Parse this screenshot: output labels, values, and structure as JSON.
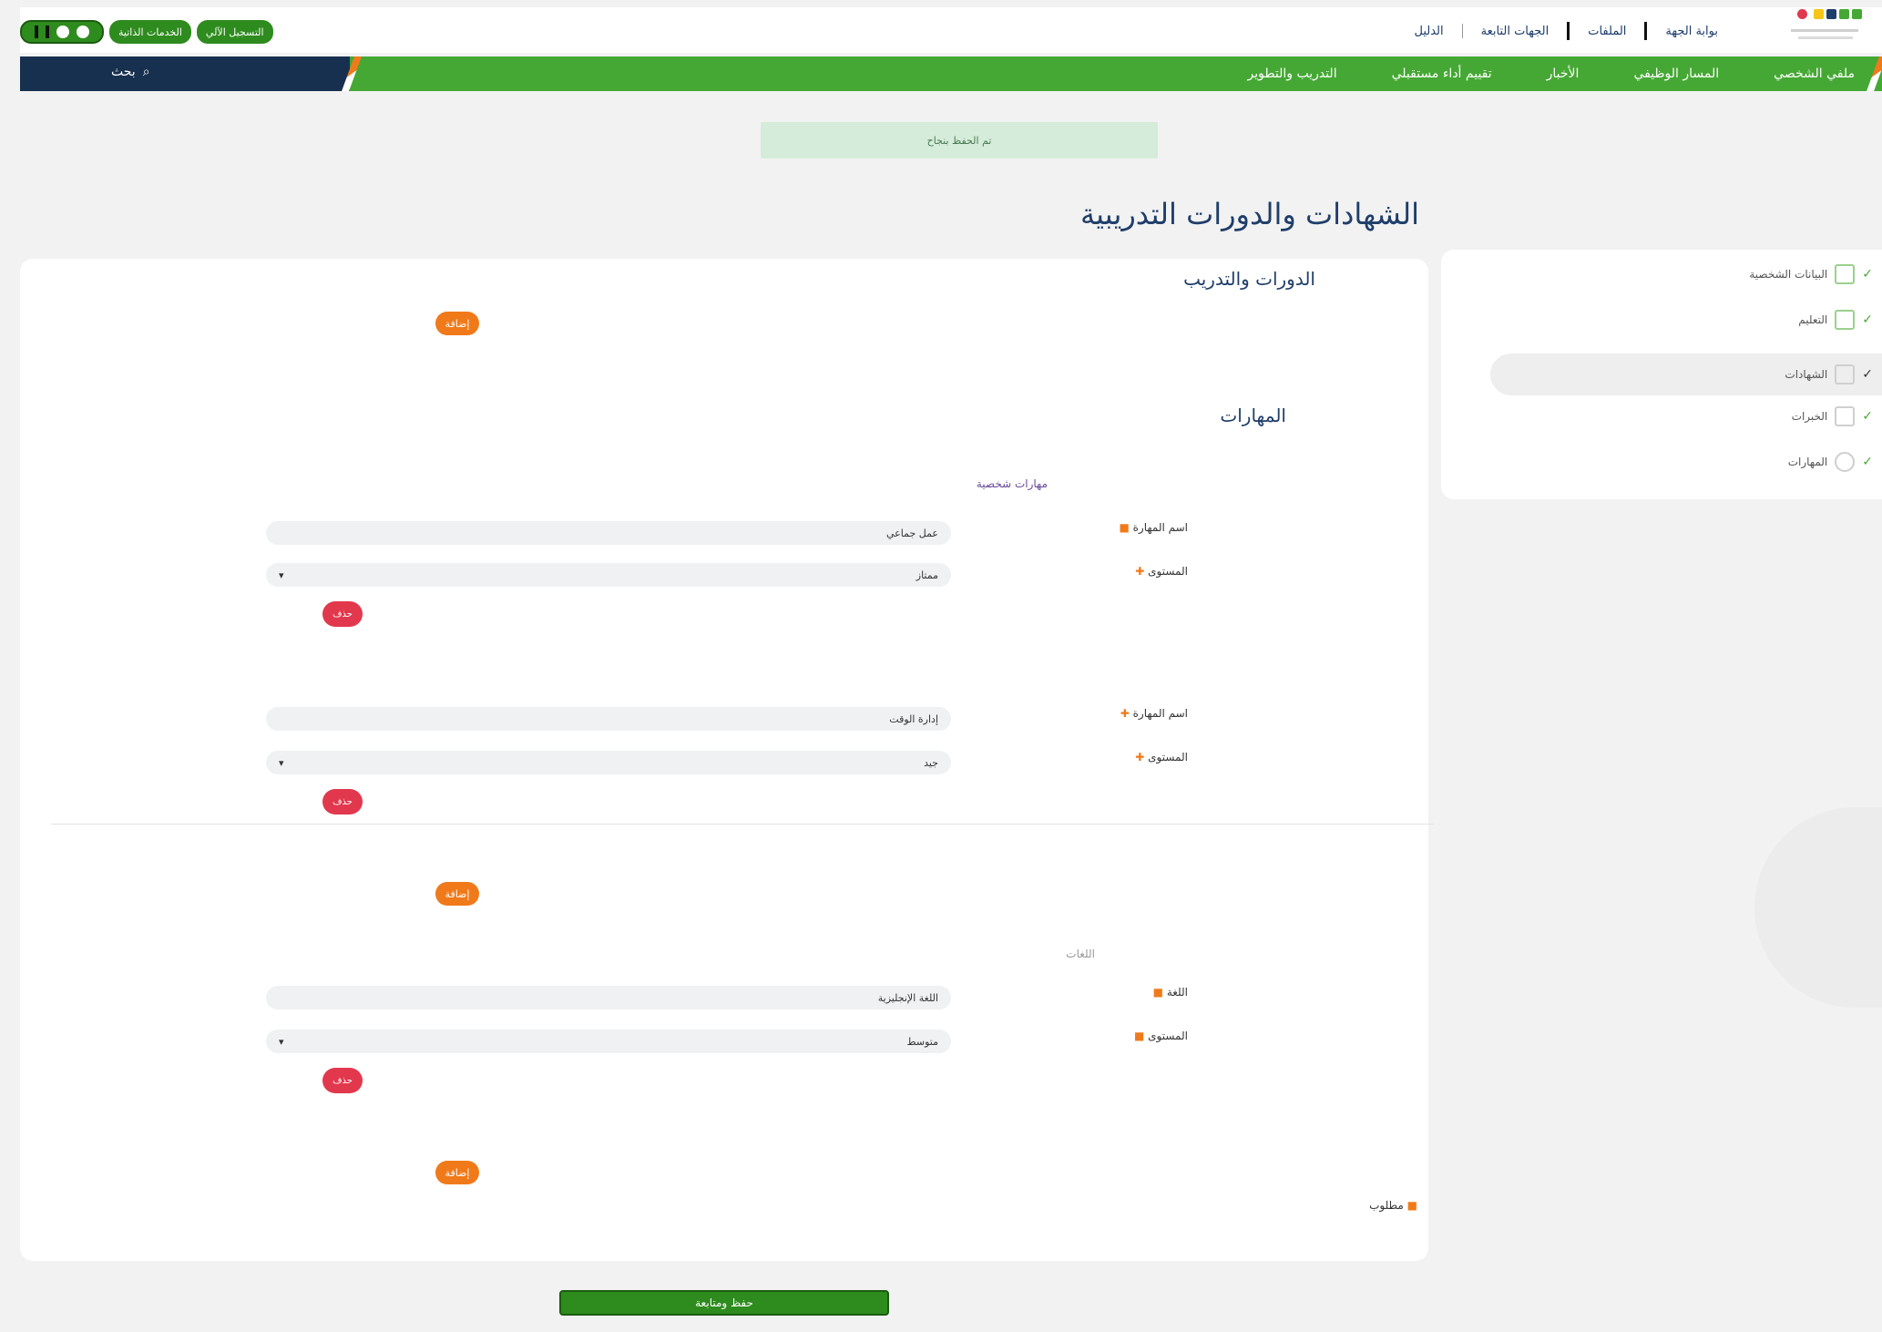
{
  "topbar": {
    "links": [
      "بوابة الجهة",
      "الملفات",
      "الجهات التابعة",
      "الدليل"
    ],
    "pills": [
      "التسجيل الآلي",
      "الخدمات الذاتية"
    ]
  },
  "navbar": {
    "items": [
      "ملفي الشخصي",
      "المسار الوظيفي",
      "الأخبار",
      "تقييم أداء مستقبلي",
      "التدريب والتطوير"
    ],
    "search_label": "بحث"
  },
  "alert": {
    "text": "تم الحفظ بنجاح"
  },
  "page": {
    "title": "الشهادات والدورات التدريبية"
  },
  "sidenav": {
    "items": [
      "البيانات الشخصية",
      "التعليم",
      "الشهادات",
      "الخبرات",
      "المهارات"
    ]
  },
  "card": {
    "section1_title": "الدورات والتدريب",
    "section2_title": "المهارات",
    "add_label": "إضافة",
    "delete_label": "حذف",
    "skills_sublabel": "مهارات شخصية",
    "skill1": {
      "name_label": "اسم المهارة",
      "name_value": "عمل جماعي",
      "level_label": "المستوى",
      "level_value": "ممتاز"
    },
    "skill2": {
      "name_label": "اسم المهارة",
      "name_value": "إدارة الوقت",
      "level_label": "المستوى",
      "level_value": "جيد"
    },
    "languages_sublabel": "اللغات",
    "lang1": {
      "name_label": "اللغة",
      "name_value": "اللغة الإنجليزية",
      "level_label": "المستوى",
      "level_value": "متوسط"
    },
    "required_note": "مطلوب",
    "save_label": "حفظ ومتابعة"
  }
}
